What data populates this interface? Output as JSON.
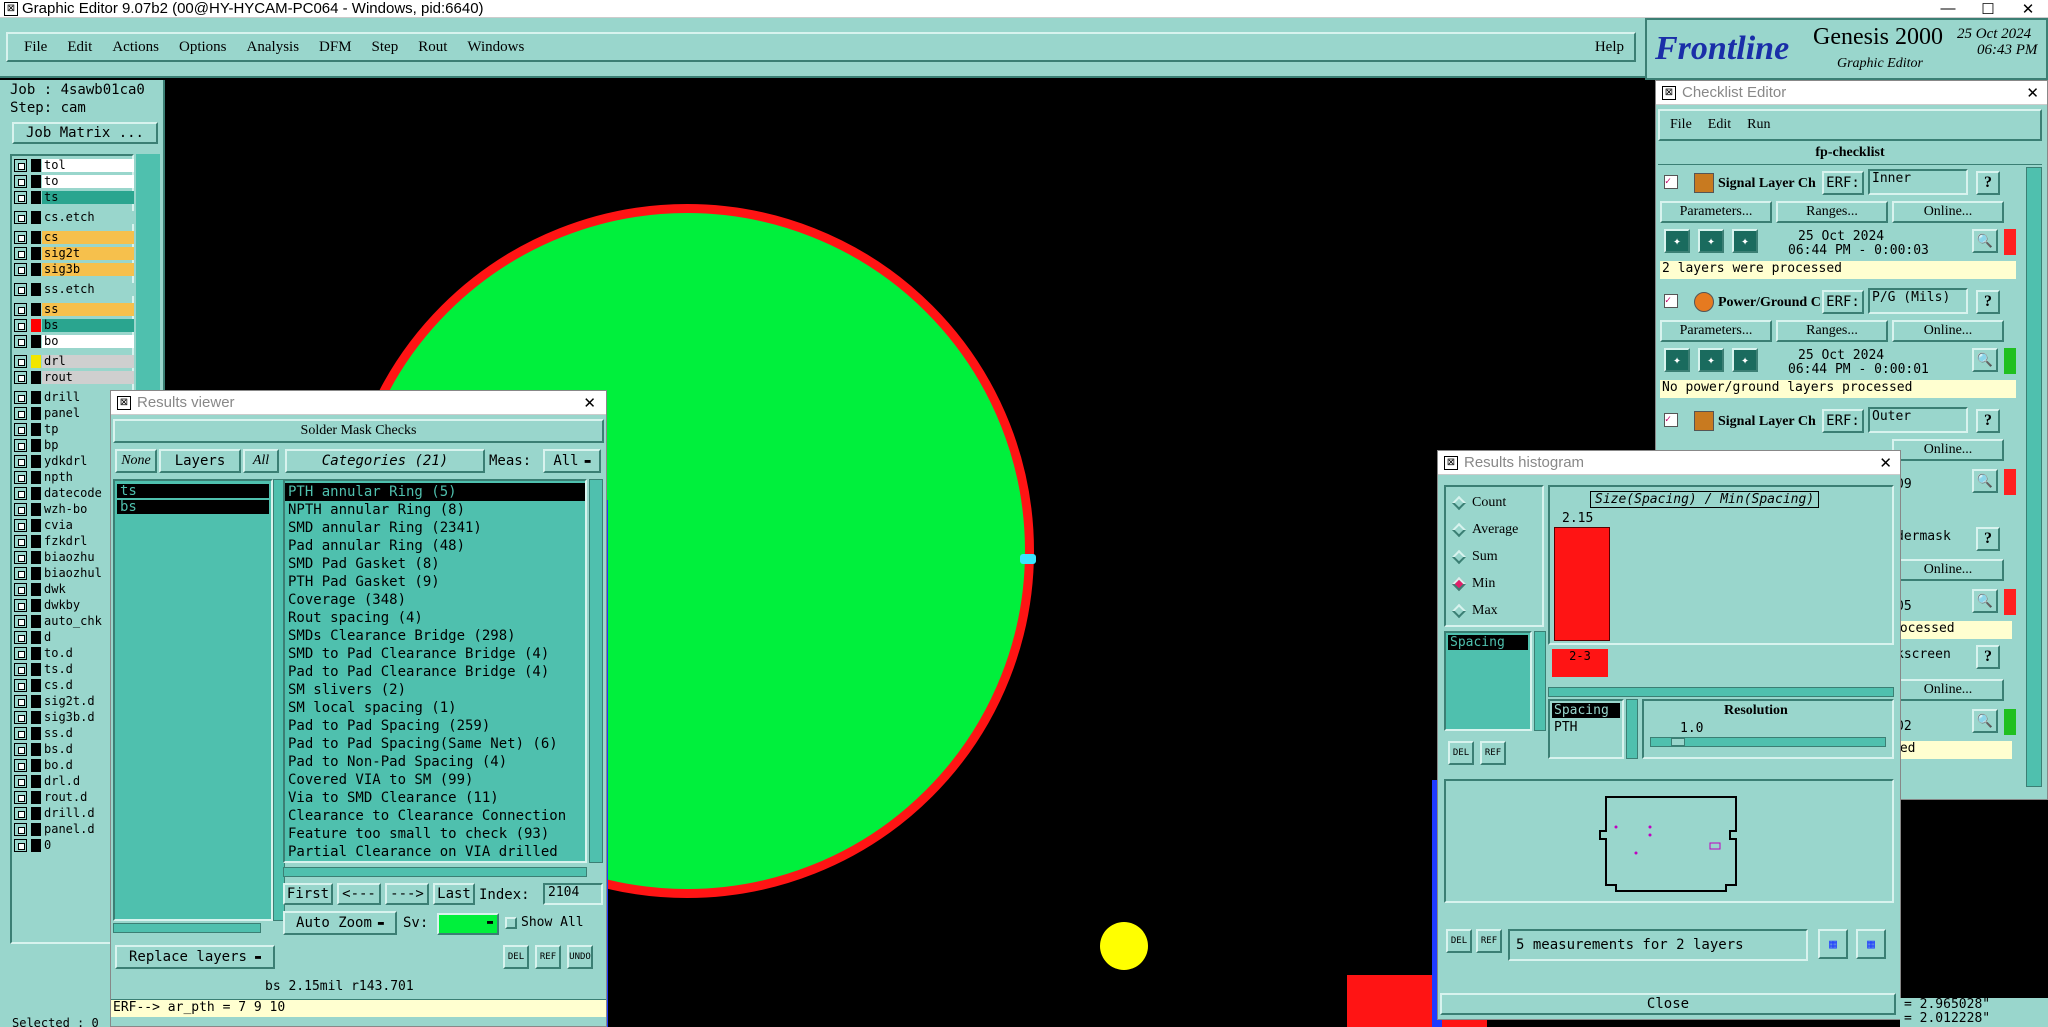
{
  "window": {
    "title": "Graphic Editor 9.07b2 (00@HY-HYCAM-PC064 - Windows, pid:6640)"
  },
  "menubar": {
    "items": [
      "File",
      "Edit",
      "Actions",
      "Options",
      "Analysis",
      "DFM",
      "Step",
      "Rout",
      "Windows"
    ],
    "help": "Help"
  },
  "brand": {
    "logo": "Frontline",
    "product": "Genesis 2000",
    "subtitle": "Graphic Editor",
    "date": "25 Oct 2024",
    "time": "06:43 PM"
  },
  "job": {
    "job": "Job : 4sawb01ca0",
    "step": "Step: cam",
    "matrix_button": "Job Matrix ..."
  },
  "layers": [
    {
      "name": "tol",
      "color": "#ffffff",
      "sw": "#000000"
    },
    {
      "name": "to",
      "color": "#ffffff",
      "sw": "#000000"
    },
    {
      "name": "ts",
      "color": "#2aa58f",
      "sw": "#000000"
    },
    {
      "name": "cs.etch",
      "color": "#99d6cc",
      "sw": "#000000"
    },
    {
      "name": "cs",
      "color": "#f6c04c",
      "sw": "#000000"
    },
    {
      "name": "sig2t",
      "color": "#f6c04c",
      "sw": "#000000"
    },
    {
      "name": "sig3b",
      "color": "#f6c04c",
      "sw": "#000000"
    },
    {
      "name": "ss.etch",
      "color": "#99d6cc",
      "sw": "#000000"
    },
    {
      "name": "ss",
      "color": "#f6c04c",
      "sw": "#000000"
    },
    {
      "name": "bs",
      "color": "#2aa58f",
      "sw": "#ff0000"
    },
    {
      "name": "bo",
      "color": "#ffffff",
      "sw": "#000000"
    },
    {
      "name": "drl",
      "color": "#cfcfcf",
      "sw": "#f2e600"
    },
    {
      "name": "rout",
      "color": "#cfcfcf",
      "sw": "#000000"
    },
    {
      "name": "drill",
      "color": "#99d6cc",
      "sw": "#000000"
    },
    {
      "name": "panel",
      "color": "#99d6cc",
      "sw": "#000000"
    },
    {
      "name": "tp",
      "color": "#99d6cc",
      "sw": "#000000"
    },
    {
      "name": "bp",
      "color": "#99d6cc",
      "sw": "#000000"
    },
    {
      "name": "ydkdrl",
      "color": "#99d6cc",
      "sw": "#000000"
    },
    {
      "name": "npth",
      "color": "#99d6cc",
      "sw": "#000000"
    },
    {
      "name": "datecode",
      "color": "#99d6cc",
      "sw": "#000000"
    },
    {
      "name": "wzh-bo",
      "color": "#99d6cc",
      "sw": "#000000"
    },
    {
      "name": "cvia",
      "color": "#99d6cc",
      "sw": "#000000"
    },
    {
      "name": "fzkdrl",
      "color": "#99d6cc",
      "sw": "#000000"
    },
    {
      "name": "biaozhu",
      "color": "#99d6cc",
      "sw": "#000000"
    },
    {
      "name": "biaozhul",
      "color": "#99d6cc",
      "sw": "#000000"
    },
    {
      "name": "dwk",
      "color": "#99d6cc",
      "sw": "#000000"
    },
    {
      "name": "dwkby",
      "color": "#99d6cc",
      "sw": "#000000"
    },
    {
      "name": "auto_chk",
      "color": "#99d6cc",
      "sw": "#000000"
    },
    {
      "name": "d",
      "color": "#99d6cc",
      "sw": "#000000"
    },
    {
      "name": "to.d",
      "color": "#99d6cc",
      "sw": "#000000"
    },
    {
      "name": "ts.d",
      "color": "#99d6cc",
      "sw": "#000000"
    },
    {
      "name": "cs.d",
      "color": "#99d6cc",
      "sw": "#000000"
    },
    {
      "name": "sig2t.d",
      "color": "#99d6cc",
      "sw": "#000000"
    },
    {
      "name": "sig3b.d",
      "color": "#99d6cc",
      "sw": "#000000"
    },
    {
      "name": "ss.d",
      "color": "#99d6cc",
      "sw": "#000000"
    },
    {
      "name": "bs.d",
      "color": "#99d6cc",
      "sw": "#000000"
    },
    {
      "name": "bo.d",
      "color": "#99d6cc",
      "sw": "#000000"
    },
    {
      "name": "drl.d",
      "color": "#99d6cc",
      "sw": "#000000"
    },
    {
      "name": "rout.d",
      "color": "#99d6cc",
      "sw": "#000000"
    },
    {
      "name": "drill.d",
      "color": "#99d6cc",
      "sw": "#000000"
    },
    {
      "name": "panel.d",
      "color": "#99d6cc",
      "sw": "#000000"
    },
    {
      "name": "0",
      "color": "#99d6cc",
      "sw": "#000000"
    }
  ],
  "selected_status": "Selected : 0",
  "results_viewer": {
    "title": "Results viewer",
    "header": "Solder Mask Checks",
    "none": "None",
    "layers_btn": "Layers",
    "all": "All",
    "categories_btn": "Categories (21)",
    "meas_label": "Meas:",
    "meas_value": "All",
    "layers": [
      "ts",
      "bs"
    ],
    "categories": [
      "PTH annular Ring (5)",
      "NPTH annular Ring (8)",
      "SMD annular Ring (2341)",
      "Pad annular Ring (48)",
      "SMD Pad Gasket (8)",
      "PTH Pad Gasket (9)",
      "Coverage (348)",
      "Rout spacing (4)",
      "SMDs Clearance Bridge (298)",
      "SMD to Pad Clearance Bridge (4)",
      "Pad to Pad Clearance Bridge (4)",
      "SM slivers (2)",
      "SM local spacing (1)",
      "Pad to Pad Spacing (259)",
      "Pad to Pad Spacing(Same Net) (6)",
      "Pad to Non-Pad Spacing (4)",
      "Covered VIA to SM (99)",
      "Via to SMD Clearance (11)",
      "Clearance to Clearance Connection",
      "Feature too small to check (93)",
      "Partial Clearance on VIA drilled"
    ],
    "nav": {
      "first": "First",
      "prev": "<---",
      "next": "--->",
      "last": "Last",
      "index_label": "Index:",
      "index_value": "2104"
    },
    "auto_zoom": "Auto Zoom",
    "sv_label": "Sv:",
    "show_all": "Show All",
    "replace_layers": "Replace layers",
    "btn_del": "DEL",
    "btn_ref": "REF",
    "btn_undo": "UNDO",
    "status": "bs 2.15mil  r143.701",
    "erf": "ERF--> ar_pth = 7 9 10"
  },
  "histogram": {
    "title": "Results histogram",
    "options": [
      "Count",
      "Average",
      "Sum",
      "Min",
      "Max"
    ],
    "selected": "Min",
    "chart_title": "Size(Spacing) / Min(Spacing)",
    "bar_value": "2.15",
    "bar_label": "2-3",
    "list_item": "Spacing",
    "table_header": "Spacing",
    "table_value": "PTH",
    "resolution_label": "Resolution",
    "resolution_value": "1.0",
    "summary": "5 measurements for 2 layers",
    "close": "Close",
    "btn_del": "DEL",
    "btn_ref": "REF"
  },
  "checklist": {
    "title": "Checklist Editor",
    "menu": [
      "File",
      "Edit",
      "Run"
    ],
    "name": "fp-checklist",
    "params": "Parameters...",
    "ranges": "Ranges...",
    "online": "Online...",
    "erf_label": "ERF:",
    "items": [
      {
        "name": "Signal Layer Ch",
        "erf": "Inner",
        "date": "25 Oct 2024",
        "time": "06:44 PM - 0:00:03",
        "msg": "2 layers were processed",
        "status": "#ff2020"
      },
      {
        "name": "Power/Ground C",
        "erf": "P/G (Mils)",
        "date": "25 Oct 2024",
        "time": "06:44 PM - 0:00:01",
        "msg": "No power/ground layers processed",
        "status": "#20c020"
      },
      {
        "name": "Signal Layer Ch",
        "erf": "Outer",
        "date": "",
        "time": "",
        "msg": "",
        "status": "#ff2020"
      }
    ],
    "partial": [
      "09",
      "dermask",
      "05",
      "rocessed",
      "kscreen",
      "02",
      "sed"
    ]
  },
  "coords": {
    "x": "= 2.965028\"",
    "y": "= 2.012228\""
  }
}
